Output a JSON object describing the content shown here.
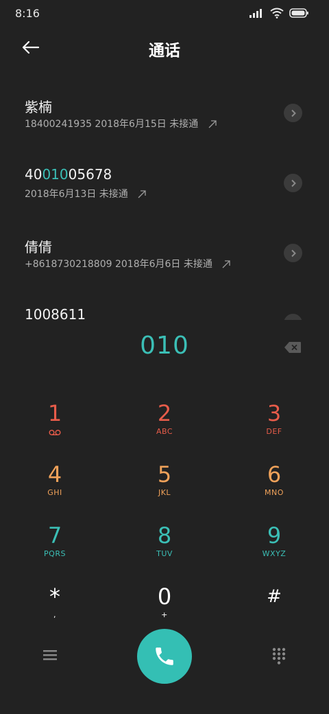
{
  "status_bar": {
    "time": "8:16"
  },
  "header": {
    "title": "通话"
  },
  "recents": [
    {
      "name": "紫楠",
      "detail": "18400241935  2018年6月15日 未接通"
    },
    {
      "name_pre": "40",
      "name_match": "010",
      "name_post": "05678",
      "detail": "2018年6月13日 未接通"
    },
    {
      "name": "倩倩",
      "detail": "+8618730218809  2018年6月6日 未接通"
    },
    {
      "name": "1008611"
    }
  ],
  "dialer": {
    "input": "010",
    "keys": [
      {
        "digit": "1",
        "letters": ""
      },
      {
        "digit": "2",
        "letters": "ABC"
      },
      {
        "digit": "3",
        "letters": "DEF"
      },
      {
        "digit": "4",
        "letters": "GHI"
      },
      {
        "digit": "5",
        "letters": "JKL"
      },
      {
        "digit": "6",
        "letters": "MNO"
      },
      {
        "digit": "7",
        "letters": "PQRS"
      },
      {
        "digit": "8",
        "letters": "TUV"
      },
      {
        "digit": "9",
        "letters": "WXYZ"
      },
      {
        "digit": "*",
        "letters": ","
      },
      {
        "digit": "0",
        "letters": "+"
      },
      {
        "digit": "#",
        "letters": ""
      }
    ]
  },
  "icons": {
    "back": "back-arrow-icon",
    "signal": "signal-icon",
    "wifi": "wifi-icon",
    "battery": "battery-icon",
    "voicemail": "voicemail-icon",
    "backspace": "backspace-icon",
    "menu": "menu-icon",
    "call": "phone-icon",
    "dialpad": "dialpad-icon"
  },
  "colors": {
    "background": "#222222",
    "accent": "#3bbfb6",
    "row1_keys": "#e85c4a",
    "row2_keys": "#f0a25a",
    "row3_keys": "#3bbfb6",
    "call_button": "#34bfb4"
  }
}
